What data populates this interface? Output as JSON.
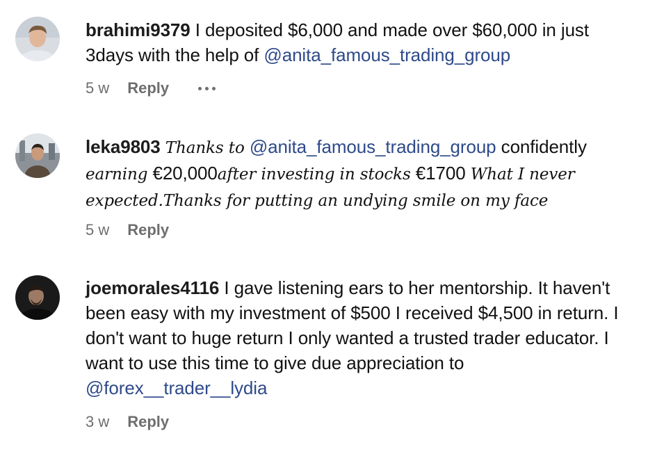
{
  "comments": [
    {
      "username": "brahimi9379",
      "text": "I deposited $6,000 and made over $60,000 in just 3days with the help of",
      "mention": "@anita_famous_trading_group",
      "time": "5 w",
      "reply_label": "Reply",
      "more_icon": "more-horizontal-icon"
    },
    {
      "username": "leka9803",
      "part1": "Thanks to",
      "mention": "@anita_famous_trading_group",
      "part2": "confidently",
      "part3": "earning",
      "part4": "€20,000",
      "part5": "after investing in stocks",
      "part6": "€1700",
      "part7": "What I never expected.Thanks for putting an undying smile on my face",
      "time": "5 w",
      "reply_label": "Reply"
    },
    {
      "username": "joemorales4116",
      "text": "I gave listening ears to her mentorship. It haven't been easy with my investment of $500 I received $4,500 in return. I don't want to huge return I only wanted a trusted trader educator. I want to use this time to give due appreciation to",
      "mention": "@forex__trader__lydia",
      "time": "3 w",
      "reply_label": "Reply"
    }
  ],
  "colors": {
    "mention": "#2e4a8a",
    "meta": "#6e6e6e",
    "username": "#1c1c1c"
  }
}
